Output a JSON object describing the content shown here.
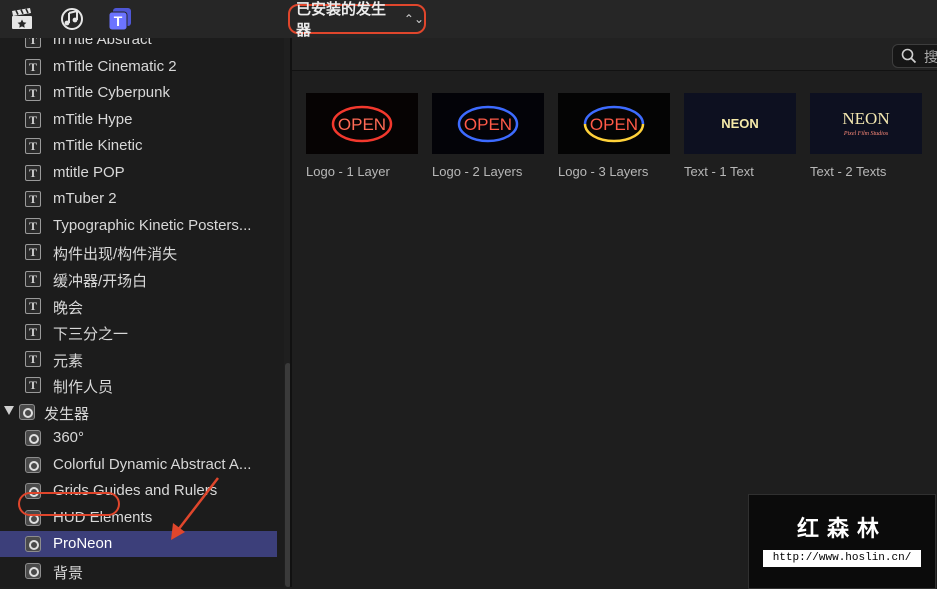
{
  "toolbar": {
    "icons": [
      "clapperboard-icon",
      "music-notes-icon",
      "titles-generators-icon"
    ],
    "dropdown_label": "已安装的发生器",
    "dropdown_chevron": "⌃⌄"
  },
  "sidebar": {
    "items": [
      {
        "label": "mTitle Abstract",
        "kind": "title"
      },
      {
        "label": "mTitle Cinematic 2",
        "kind": "title"
      },
      {
        "label": "mTitle Cyberpunk",
        "kind": "title"
      },
      {
        "label": "mTitle Hype",
        "kind": "title"
      },
      {
        "label": "mTitle Kinetic",
        "kind": "title"
      },
      {
        "label": "mtitle POP",
        "kind": "title"
      },
      {
        "label": "mTuber 2",
        "kind": "title"
      },
      {
        "label": "Typographic Kinetic Posters...",
        "kind": "title"
      },
      {
        "label": "构件出现/构件消失",
        "kind": "title"
      },
      {
        "label": "缓冲器/开场白",
        "kind": "title"
      },
      {
        "label": "晚会",
        "kind": "title"
      },
      {
        "label": "下三分之一",
        "kind": "title"
      },
      {
        "label": "元素",
        "kind": "title"
      },
      {
        "label": "制作人员",
        "kind": "title"
      },
      {
        "label": "发生器",
        "kind": "section"
      },
      {
        "label": "360°",
        "kind": "generator"
      },
      {
        "label": "Colorful Dynamic Abstract A...",
        "kind": "generator"
      },
      {
        "label": "Grids Guides and Rulers",
        "kind": "generator"
      },
      {
        "label": "HUD Elements",
        "kind": "generator"
      },
      {
        "label": "ProNeon",
        "kind": "generator",
        "selected": true
      },
      {
        "label": "背景",
        "kind": "generator"
      }
    ]
  },
  "search": {
    "placeholder": "搜"
  },
  "tiles": [
    {
      "label": "Logo - 1 Layer",
      "thumb_text": "OPEN"
    },
    {
      "label": "Logo - 2 Layers",
      "thumb_text": "OPEN"
    },
    {
      "label": "Logo - 3 Layers",
      "thumb_text": "OPEN"
    },
    {
      "label": "Text - 1 Text",
      "thumb_text": "NEON"
    },
    {
      "label": "Text - 2 Texts",
      "thumb_text": "NEON",
      "thumb_subtext": "Pixel Film Studios"
    }
  ],
  "watermark": {
    "title": "红森林",
    "url": "http://www.hoslin.cn/"
  },
  "colors": {
    "selection": "#3c3f7a",
    "annotation": "#e0462c",
    "neon_red": "#ff3b2f",
    "neon_blue": "#3d6bff",
    "neon_yellow": "#ffd23a"
  }
}
